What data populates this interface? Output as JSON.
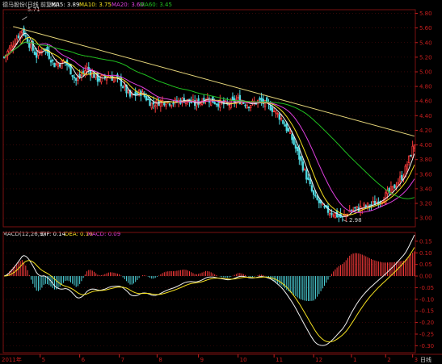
{
  "header": {
    "name": "德马股份(日线 前复权)",
    "ma5_label": "MA5: 3.89",
    "ma10_label": "MA10: 3.75",
    "ma20_label": "MA20: 3.60",
    "ma60_label": "MA60: 3.45"
  },
  "macd_header": {
    "name": "MACD(12,26,9)",
    "dif_label": "DIF: 0.14",
    "dea_label": "DEA: 0.10",
    "macd_label": "MACD: 0.09"
  },
  "colors": {
    "background": "#000000",
    "up": "#ff3c3c",
    "down": "#4fd8e0",
    "ma5": "#f0f0f0",
    "ma10": "#f4e020",
    "ma20": "#e040e0",
    "ma60": "#20c020",
    "trendline": "#e6d67a",
    "axis": "#c81e1e",
    "dif": "#f0f0f0",
    "dea": "#f4e020"
  },
  "bottom_axis": {
    "year_label": "2011年",
    "months": [
      "5",
      "6",
      "7",
      "8",
      "9",
      "10",
      "11",
      "12",
      "1",
      "2",
      "3"
    ],
    "period_label": "日线"
  },
  "chart_data": [
    {
      "type": "candlestick",
      "title": "德马股份(日线 前复权)",
      "ylim": [
        2.88,
        5.85
      ],
      "yticks": [
        3.0,
        3.2,
        3.4,
        3.6,
        3.8,
        4.0,
        4.2,
        4.4,
        4.6,
        4.8,
        5.0,
        5.2,
        5.4,
        5.6,
        5.8
      ],
      "ytick_labels": [
        "3.00",
        "3.20",
        "3.40",
        "3.60",
        "3.80",
        "4.00",
        "4.20",
        "4.40",
        "4.60",
        "4.80",
        "5.00",
        "5.20",
        "5.40",
        "5.60",
        "5.80"
      ],
      "annotations": [
        {
          "text": "5.71",
          "kind": "high"
        },
        {
          "text": "2.98",
          "kind": "low"
        }
      ],
      "keypoints": [
        [
          0,
          5.2
        ],
        [
          6,
          5.42
        ],
        [
          10,
          5.58
        ],
        [
          14,
          5.38
        ],
        [
          18,
          5.22
        ],
        [
          22,
          5.34
        ],
        [
          28,
          5.1
        ],
        [
          34,
          5.14
        ],
        [
          40,
          4.88
        ],
        [
          46,
          5.05
        ],
        [
          52,
          4.9
        ],
        [
          58,
          4.94
        ],
        [
          64,
          4.88
        ],
        [
          70,
          4.66
        ],
        [
          76,
          4.72
        ],
        [
          82,
          4.56
        ],
        [
          88,
          4.6
        ],
        [
          94,
          4.58
        ],
        [
          100,
          4.62
        ],
        [
          106,
          4.56
        ],
        [
          112,
          4.64
        ],
        [
          118,
          4.58
        ],
        [
          124,
          4.55
        ],
        [
          130,
          4.62
        ],
        [
          136,
          4.55
        ],
        [
          142,
          4.6
        ],
        [
          148,
          4.52
        ],
        [
          154,
          4.36
        ],
        [
          160,
          4.08
        ],
        [
          166,
          3.7
        ],
        [
          172,
          3.3
        ],
        [
          178,
          3.12
        ],
        [
          184,
          3.05
        ],
        [
          188,
          3.0
        ],
        [
          192,
          3.1
        ],
        [
          198,
          3.14
        ],
        [
          204,
          3.18
        ],
        [
          210,
          3.26
        ],
        [
          216,
          3.4
        ],
        [
          222,
          3.6
        ],
        [
          228,
          4.02
        ]
      ],
      "moving_averages": [
        {
          "name": "MA5",
          "value": 3.89
        },
        {
          "name": "MA10",
          "value": 3.75
        },
        {
          "name": "MA20",
          "value": 3.6
        },
        {
          "name": "MA60",
          "value": 3.45
        }
      ],
      "trendline": {
        "from": [
          5,
          5.62
        ],
        "to": [
          228,
          4.12
        ]
      },
      "grid": true
    },
    {
      "type": "macd",
      "title": "MACD(12,26,9)",
      "ylim": [
        -0.33,
        0.16
      ],
      "yticks": [
        0.15,
        0.1,
        0.05,
        0.0,
        -0.05,
        -0.1,
        -0.15,
        -0.2,
        -0.25,
        -0.3
      ],
      "ytick_labels": [
        "0.15",
        "0.10",
        "0.05",
        "0.00",
        "-0.05",
        "-0.10",
        "-0.15",
        "-0.20",
        "-0.25",
        "-0.30"
      ],
      "series": [
        {
          "name": "DIF",
          "value": 0.14
        },
        {
          "name": "DEA",
          "value": 0.1
        },
        {
          "name": "MACD",
          "value": 0.09
        }
      ]
    }
  ]
}
